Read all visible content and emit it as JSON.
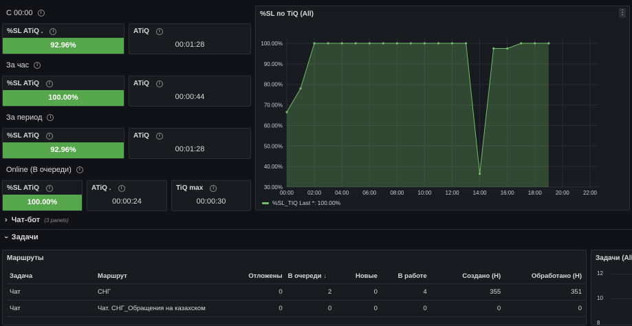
{
  "sections": [
    {
      "title": "С 00:00",
      "sl_label": "%SL ATiQ .",
      "sl_value": "92.96%",
      "atiq_label": "ATiQ",
      "atiq_value": "00:01:28"
    },
    {
      "title": "За час",
      "sl_label": "%SL ATiQ",
      "sl_value": "100.00%",
      "atiq_label": "ATiQ",
      "atiq_value": "00:00:44"
    },
    {
      "title": "За период",
      "sl_label": "%SL ATiQ",
      "sl_value": "92.96%",
      "atiq_label": "ATiQ",
      "atiq_value": "00:01:28"
    }
  ],
  "online": {
    "title": "Online (В очереди)",
    "sl_label": "%SL ATiQ",
    "sl_value": "100.00%",
    "atiq_label": "ATiQ .",
    "atiq_value": "00:00:24",
    "tiqmax_label": "TiQ max",
    "tiqmax_value": "00:00:30"
  },
  "gauge_color": "#56a64b",
  "sl_panel": {
    "title": "%SL по TiQ (All)",
    "menu_icon": "kebab-menu-icon",
    "legend": "%SL_TIQ  Last *: 100.00%"
  },
  "chart_data": {
    "type": "line",
    "title": "%SL по TiQ (All)",
    "xlabel": "",
    "ylabel": "",
    "xlim": [
      "00:00",
      "23:00"
    ],
    "ylim": [
      30,
      100
    ],
    "x_ticks": [
      "00:00",
      "02:00",
      "04:00",
      "06:00",
      "08:00",
      "10:00",
      "12:00",
      "14:00",
      "16:00",
      "18:00",
      "20:00",
      "22:00"
    ],
    "y_ticks": [
      "100.00%",
      "90.00%",
      "80.00%",
      "70.00%",
      "60.00%",
      "50.00%",
      "40.00%",
      "30.00%"
    ],
    "grid": true,
    "legend": "bottom-left",
    "series": [
      {
        "name": "%SL_TIQ",
        "color": "#73bf69",
        "fill": "area",
        "x": [
          0.0,
          1.0,
          2.0,
          3.0,
          4.0,
          5.0,
          6.0,
          7.0,
          8.0,
          9.0,
          10.0,
          11.0,
          12.0,
          13.0,
          14.0,
          15.0,
          16.0,
          17.0,
          18.0,
          19.0
        ],
        "y": [
          66.5,
          78,
          100,
          100,
          100,
          100,
          100,
          100,
          100,
          100,
          100,
          100,
          100,
          100,
          36.5,
          97.5,
          97.5,
          100,
          100,
          100
        ]
      }
    ]
  },
  "chatbot_row": {
    "title": "Чат-бот",
    "subtitle": "(3 panels)"
  },
  "tasks_row": {
    "title": "Задачи"
  },
  "routes": {
    "title": "Маршруты",
    "columns": [
      "Задача",
      "Маршрут",
      "Отложены",
      "В очереди",
      "Новые",
      "В работе",
      "Создано (Н)",
      "Обработано (Н)"
    ],
    "sort_column_arrow": "↓",
    "rows": [
      [
        "Чат",
        "СНГ",
        "0",
        "2",
        "0",
        "4",
        "355",
        "351"
      ],
      [
        "Чат",
        "Чат. СНГ_Обращения на казахском",
        "0",
        "0",
        "0",
        "0",
        "0",
        "0"
      ]
    ]
  },
  "tasks_all_panel": {
    "title": "Задачи (All)",
    "y_ticks": [
      "12",
      "10",
      "8"
    ]
  }
}
